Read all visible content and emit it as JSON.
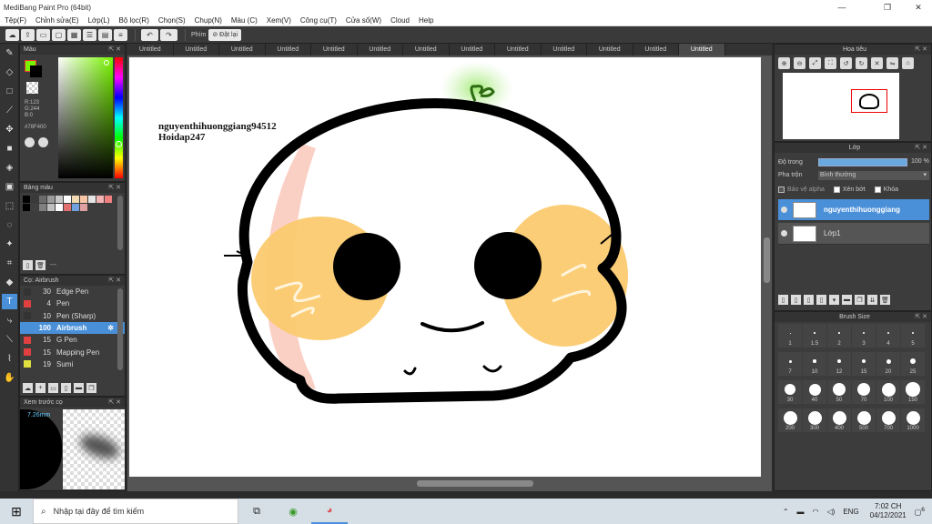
{
  "window": {
    "title": "MediBang Paint Pro (64bit)",
    "minimize": "—",
    "maximize": "❐",
    "close": "✕"
  },
  "menu": [
    "Tệp(F)",
    "Chỉnh sửa(E)",
    "Lớp(L)",
    "Bộ lọc(R)",
    "Chọn(S)",
    "Chụp(N)",
    "Màu (C)",
    "Xem(V)",
    "Công cụ(T)",
    "Cửa số(W)",
    "Cloud",
    "Help"
  ],
  "toolbar": {
    "label_phim": "Phím",
    "reset_label": "Đặt lại",
    "undo": "↶",
    "redo": "↷"
  },
  "color_panel": {
    "title": "Màu",
    "r": "R:123",
    "g": "G:244",
    "b": "B:0",
    "hex": "#78F400",
    "fg_color": "#78f400"
  },
  "palette_panel": {
    "title": "Bảng màu",
    "dash": "---",
    "colors": [
      "#000000",
      "#3a3a3a",
      "#6b6b6b",
      "#9b9b9b",
      "#c8c8c8",
      "#ffffff",
      "#f2d9b1",
      "#f7c6a5",
      "#e5e5e5",
      "#f4b3b3",
      "#f08080",
      "#000000",
      "#404040",
      "#808080",
      "#c0c0c0",
      "#ffffff",
      "#e07070",
      "#70a0e0",
      "#e0a0a0"
    ]
  },
  "brush_panel": {
    "title": "Cọ: Airbrush",
    "items": [
      {
        "size": "30",
        "name": "Edge Pen",
        "color": "#333333"
      },
      {
        "size": "4",
        "name": "Pen",
        "color": "#e04040"
      },
      {
        "size": "10",
        "name": "Pen (Sharp)",
        "color": "#333333"
      },
      {
        "size": "100",
        "name": "Airbrush",
        "color": "#4a90d9"
      },
      {
        "size": "15",
        "name": "G Pen",
        "color": "#e04040"
      },
      {
        "size": "15",
        "name": "Mapping Pen",
        "color": "#e04040"
      },
      {
        "size": "19",
        "name": "Sumi",
        "color": "#e0e040"
      }
    ]
  },
  "preview_panel": {
    "title": "Xem trước cọ",
    "size": "7.26mm"
  },
  "tabs": [
    "Untitled",
    "Untitled",
    "Untitled",
    "Untitled",
    "Untitled",
    "Untitled",
    "Untitled",
    "Untitled",
    "Untitled",
    "Untitled",
    "Untitled",
    "Untitled",
    "Untitled"
  ],
  "canvas": {
    "text_line1": "nguyenthihuonggiang94512",
    "text_line2": "Hoidap247"
  },
  "navigator_panel": {
    "title": "Hoa tiêu"
  },
  "layer_panel": {
    "title": "Lớp",
    "opacity_label": "Độ trong",
    "opacity_value": "100 %",
    "blend_label": "Pha trộn",
    "blend_value": "Bình thường",
    "protect_alpha": "Bảo vệ alpha",
    "clipping": "Xén bớt",
    "lock": "Khóa",
    "layers": [
      {
        "name": "nguyenthihuonggiang"
      },
      {
        "name": "Lớp1"
      }
    ]
  },
  "brushsize_panel": {
    "title": "Brush Size",
    "sizes": [
      "1",
      "1.5",
      "2",
      "3",
      "4",
      "5",
      "7",
      "10",
      "12",
      "15",
      "20",
      "25",
      "30",
      "40",
      "50",
      "70",
      "100",
      "150",
      "200",
      "300",
      "400",
      "500",
      "700",
      "1000"
    ]
  },
  "taskbar": {
    "search_placeholder": "Nhập tại đây để tìm kiếm",
    "lang": "ENG",
    "time": "7:02 CH",
    "date": "04/12/2021",
    "notification_count": "6"
  }
}
